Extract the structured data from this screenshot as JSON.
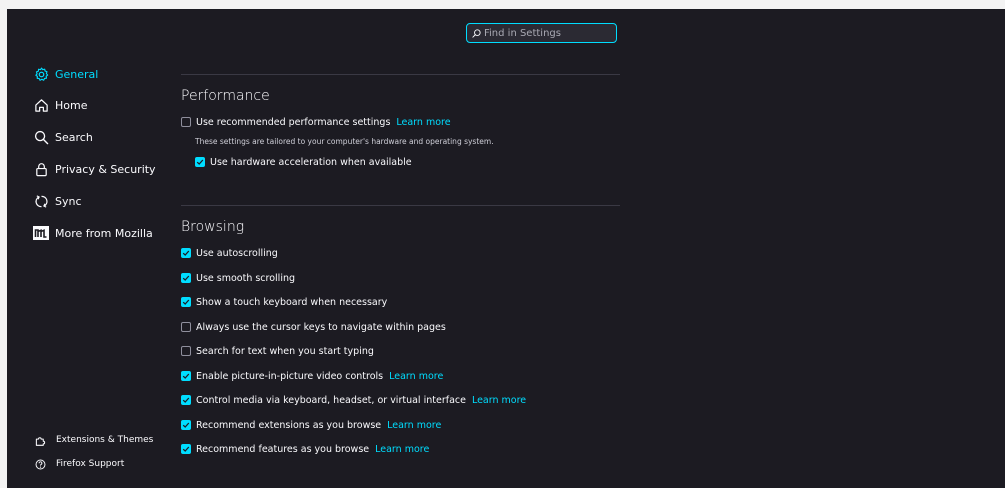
{
  "search": {
    "placeholder": "Find in Settings"
  },
  "sidebar": {
    "items": [
      {
        "label": "General"
      },
      {
        "label": "Home"
      },
      {
        "label": "Search"
      },
      {
        "label": "Privacy & Security"
      },
      {
        "label": "Sync"
      },
      {
        "label": "More from Mozilla"
      }
    ],
    "footer": [
      {
        "label": "Extensions & Themes"
      },
      {
        "label": "Firefox Support"
      }
    ]
  },
  "performance": {
    "heading": "Performance",
    "recommended": {
      "label": "Use recommended performance settings",
      "checked": false,
      "link": "Learn more"
    },
    "description": "These settings are tailored to your computer's hardware and operating system.",
    "hardware": {
      "label": "Use hardware acceleration when available",
      "checked": true
    }
  },
  "browsing": {
    "heading": "Browsing",
    "options": [
      {
        "label": "Use autoscrolling",
        "checked": true
      },
      {
        "label": "Use smooth scrolling",
        "checked": true
      },
      {
        "label": "Show a touch keyboard when necessary",
        "checked": true
      },
      {
        "label": "Always use the cursor keys to navigate within pages",
        "checked": false
      },
      {
        "label": "Search for text when you start typing",
        "checked": false
      },
      {
        "label": "Enable picture-in-picture video controls",
        "checked": true,
        "link": "Learn more"
      },
      {
        "label": "Control media via keyboard, headset, or virtual interface",
        "checked": true,
        "link": "Learn more"
      },
      {
        "label": "Recommend extensions as you browse",
        "checked": true,
        "link": "Learn more"
      },
      {
        "label": "Recommend features as you browse",
        "checked": true,
        "link": "Learn more"
      }
    ]
  },
  "colors": {
    "accent": "#00ddff",
    "background": "#1c1b22",
    "text": "#fbfbfe"
  }
}
